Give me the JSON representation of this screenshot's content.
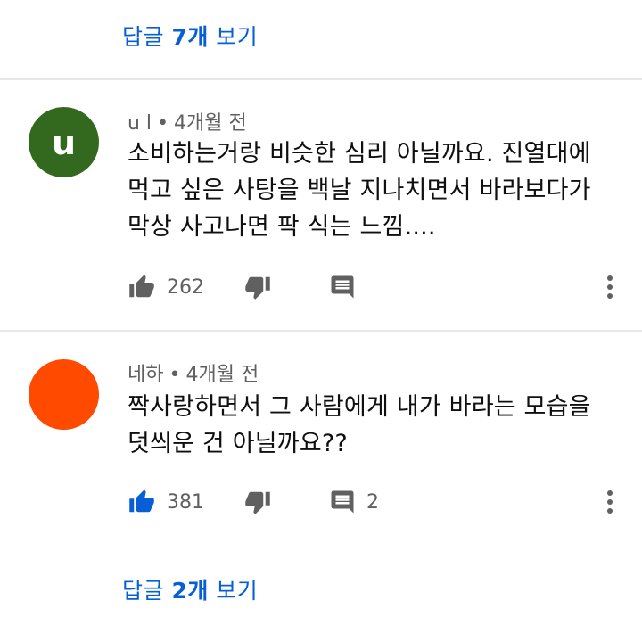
{
  "replies_top": {
    "prefix": "답글 ",
    "count": "7개",
    "suffix": " 보기"
  },
  "comments": [
    {
      "author": "u l",
      "separator": "•",
      "time": "4개월 전",
      "avatar_letter": "u",
      "avatar_color": "#33691e",
      "lines": [
        "소비하는거랑 비슷한 심리 아닐까요. 진열대에",
        "먹고 싶은 사탕을 백날 지나치면서 바라보다가",
        "막상 사고나면 팍 식는 느낌...."
      ],
      "likes": "262",
      "liked": false,
      "reply_count": ""
    },
    {
      "author": "네하",
      "separator": "•",
      "time": "4개월 전",
      "avatar_letter": "",
      "avatar_color": "#ff4a00",
      "lines": [
        "짝사랑하면서 그 사람에게 내가 바라는 모습을",
        "덧씌운 건 아닐까요??"
      ],
      "likes": "381",
      "liked": true,
      "reply_count": "2"
    }
  ],
  "replies_bottom": {
    "prefix": "답글 ",
    "count": "2개",
    "suffix": " 보기"
  },
  "icons": {
    "like": "thumbs-up-icon",
    "dislike": "thumbs-down-icon",
    "reply": "comment-icon",
    "more": "more-vert-icon"
  },
  "colors": {
    "link": "#065fd4",
    "muted": "#606060",
    "icon_gray": "#606060",
    "liked_blue": "#065fd4"
  }
}
